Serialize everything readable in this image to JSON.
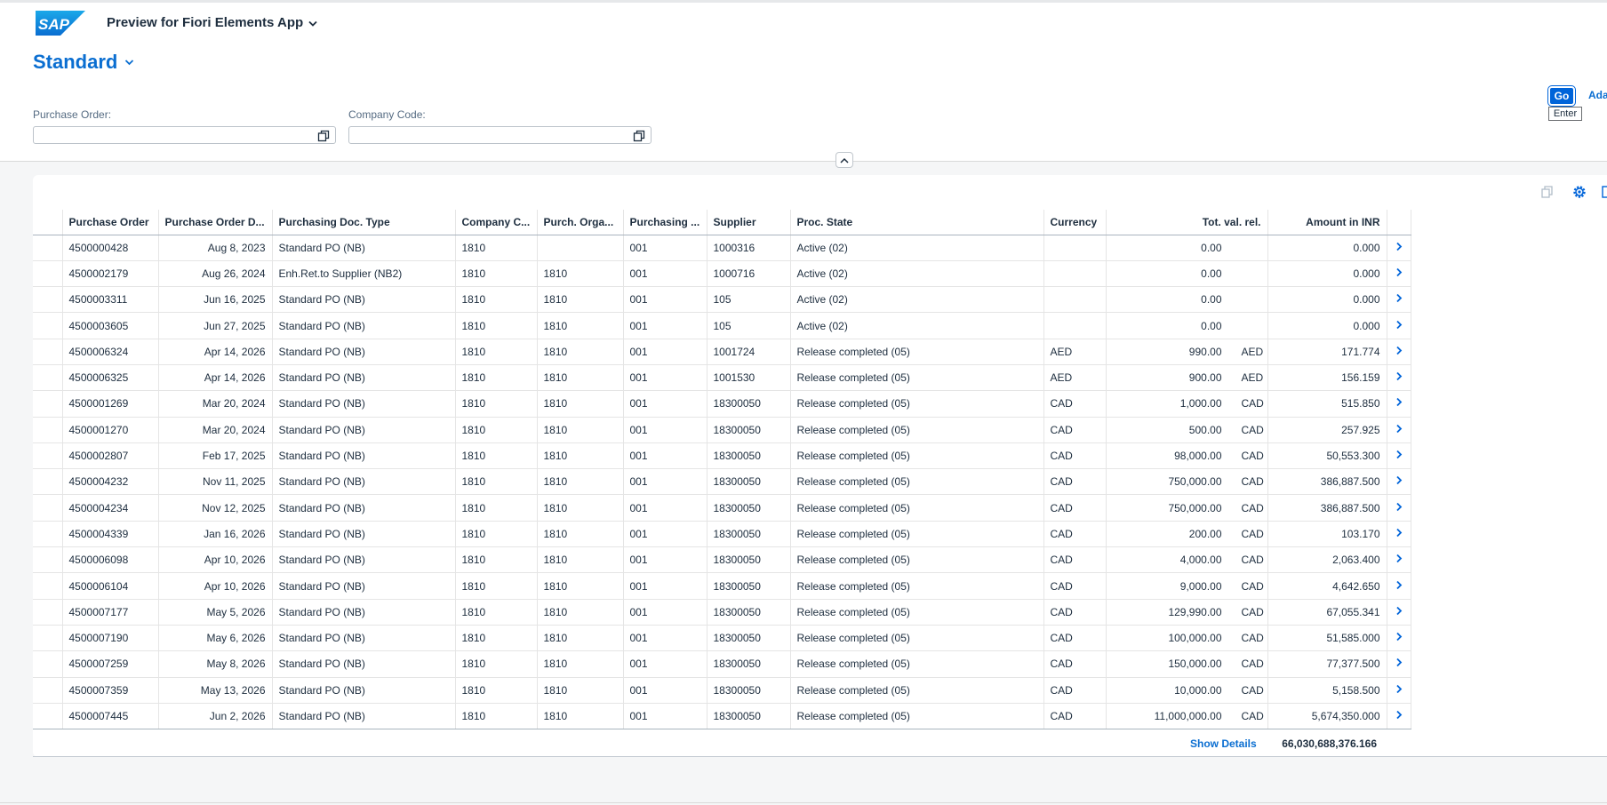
{
  "shell": {
    "logo_text": "SAP",
    "app_title": "Preview for Fiori Elements App"
  },
  "header": {
    "variant": "Standard",
    "filters": [
      {
        "label": "Purchase Order:",
        "value": ""
      },
      {
        "label": "Company Code:",
        "value": ""
      }
    ],
    "go_label": "Go",
    "go_tooltip": "Enter",
    "adapt_label": "Ada"
  },
  "table": {
    "columns": [
      "Purchase Order",
      "Purchase Order D...",
      "Purchasing Doc. Type",
      "Company C...",
      "Purch. Orga...",
      "Purchasing ...",
      "Supplier",
      "Proc. State",
      "Currency",
      "Tot. val. rel.",
      "Amount in INR"
    ],
    "rows": [
      [
        "4500000428",
        "Aug 8, 2023",
        "Standard PO (NB)",
        "1810",
        "",
        "001",
        "1000316",
        "Active (02)",
        "",
        "0.00",
        "",
        "0.000"
      ],
      [
        "4500002179",
        "Aug 26, 2024",
        "Enh.Ret.to Supplier (NB2)",
        "1810",
        "1810",
        "001",
        "1000716",
        "Active (02)",
        "",
        "0.00",
        "",
        "0.000"
      ],
      [
        "4500003311",
        "Jun 16, 2025",
        "Standard PO (NB)",
        "1810",
        "1810",
        "001",
        "105",
        "Active (02)",
        "",
        "0.00",
        "",
        "0.000"
      ],
      [
        "4500003605",
        "Jun 27, 2025",
        "Standard PO (NB)",
        "1810",
        "1810",
        "001",
        "105",
        "Active (02)",
        "",
        "0.00",
        "",
        "0.000"
      ],
      [
        "4500006324",
        "Apr 14, 2026",
        "Standard PO (NB)",
        "1810",
        "1810",
        "001",
        "1001724",
        "Release completed (05)",
        "AED",
        "990.00",
        "AED",
        "171.774"
      ],
      [
        "4500006325",
        "Apr 14, 2026",
        "Standard PO (NB)",
        "1810",
        "1810",
        "001",
        "1001530",
        "Release completed (05)",
        "AED",
        "900.00",
        "AED",
        "156.159"
      ],
      [
        "4500001269",
        "Mar 20, 2024",
        "Standard PO (NB)",
        "1810",
        "1810",
        "001",
        "18300050",
        "Release completed (05)",
        "CAD",
        "1,000.00",
        "CAD",
        "515.850"
      ],
      [
        "4500001270",
        "Mar 20, 2024",
        "Standard PO (NB)",
        "1810",
        "1810",
        "001",
        "18300050",
        "Release completed (05)",
        "CAD",
        "500.00",
        "CAD",
        "257.925"
      ],
      [
        "4500002807",
        "Feb 17, 2025",
        "Standard PO (NB)",
        "1810",
        "1810",
        "001",
        "18300050",
        "Release completed (05)",
        "CAD",
        "98,000.00",
        "CAD",
        "50,553.300"
      ],
      [
        "4500004232",
        "Nov 11, 2025",
        "Standard PO (NB)",
        "1810",
        "1810",
        "001",
        "18300050",
        "Release completed (05)",
        "CAD",
        "750,000.00",
        "CAD",
        "386,887.500"
      ],
      [
        "4500004234",
        "Nov 12, 2025",
        "Standard PO (NB)",
        "1810",
        "1810",
        "001",
        "18300050",
        "Release completed (05)",
        "CAD",
        "750,000.00",
        "CAD",
        "386,887.500"
      ],
      [
        "4500004339",
        "Jan 16, 2026",
        "Standard PO (NB)",
        "1810",
        "1810",
        "001",
        "18300050",
        "Release completed (05)",
        "CAD",
        "200.00",
        "CAD",
        "103.170"
      ],
      [
        "4500006098",
        "Apr 10, 2026",
        "Standard PO (NB)",
        "1810",
        "1810",
        "001",
        "18300050",
        "Release completed (05)",
        "CAD",
        "4,000.00",
        "CAD",
        "2,063.400"
      ],
      [
        "4500006104",
        "Apr 10, 2026",
        "Standard PO (NB)",
        "1810",
        "1810",
        "001",
        "18300050",
        "Release completed (05)",
        "CAD",
        "9,000.00",
        "CAD",
        "4,642.650"
      ],
      [
        "4500007177",
        "May 5, 2026",
        "Standard PO (NB)",
        "1810",
        "1810",
        "001",
        "18300050",
        "Release completed (05)",
        "CAD",
        "129,990.00",
        "CAD",
        "67,055.341"
      ],
      [
        "4500007190",
        "May 6, 2026",
        "Standard PO (NB)",
        "1810",
        "1810",
        "001",
        "18300050",
        "Release completed (05)",
        "CAD",
        "100,000.00",
        "CAD",
        "51,585.000"
      ],
      [
        "4500007259",
        "May 8, 2026",
        "Standard PO (NB)",
        "1810",
        "1810",
        "001",
        "18300050",
        "Release completed (05)",
        "CAD",
        "150,000.00",
        "CAD",
        "77,377.500"
      ],
      [
        "4500007359",
        "May 13, 2026",
        "Standard PO (NB)",
        "1810",
        "1810",
        "001",
        "18300050",
        "Release completed (05)",
        "CAD",
        "10,000.00",
        "CAD",
        "5,158.500"
      ],
      [
        "4500007445",
        "Jun 2, 2026",
        "Standard PO (NB)",
        "1810",
        "1810",
        "001",
        "18300050",
        "Release completed (05)",
        "CAD",
        "11,000,000.00",
        "CAD",
        "5,674,350.000"
      ]
    ],
    "show_details": "Show Details",
    "grand_total": "66,030,688,376.166"
  },
  "colors": {
    "brand_blue": "#0a6ed1",
    "button_blue": "#0064d9",
    "text": "#1d2d3e",
    "background": "#f5f6f7"
  },
  "icons": {
    "logo": "sap-logo",
    "title_dropdown": "chevron-down-icon",
    "value_help": "value-help-icon",
    "collapse": "chevron-up-icon",
    "copy": "copy-icon",
    "settings": "gear-icon",
    "export": "export-icon",
    "row_nav": "chevron-right-icon"
  }
}
